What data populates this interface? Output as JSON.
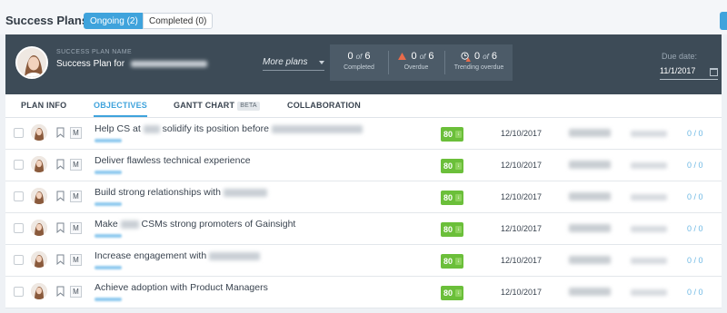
{
  "page": {
    "title": "Success Plans",
    "filters": [
      {
        "label": "Ongoing (2)",
        "active": true
      },
      {
        "label": "Completed (0)",
        "active": false
      }
    ]
  },
  "plan_header": {
    "label": "SUCCESS PLAN NAME",
    "name_prefix": "Success Plan for",
    "more_plans": "More plans",
    "stats": {
      "completed": {
        "value": "0",
        "of": "of",
        "total": "6",
        "label": "Completed"
      },
      "overdue": {
        "value": "0",
        "of": "of",
        "total": "6",
        "label": "Overdue"
      },
      "trending": {
        "value": "0",
        "of": "of",
        "total": "6",
        "label": "Trending overdue"
      }
    },
    "due_label": "Due date:",
    "due_value": "11/1/2017"
  },
  "tabs": [
    {
      "label": "PLAN INFO",
      "active": false
    },
    {
      "label": "OBJECTIVES",
      "active": true
    },
    {
      "label": "GANTT CHART",
      "badge": "BETA",
      "active": false
    },
    {
      "label": "COLLABORATION",
      "active": false
    }
  ],
  "objectives": [
    {
      "text": "Help CS at",
      "text_mid": "solidify its position before",
      "m": "M",
      "score": "80",
      "date": "12/10/2017",
      "tasks": "0 / 0"
    },
    {
      "text": "Deliver flawless technical experience",
      "m": "M",
      "score": "80",
      "date": "12/10/2017",
      "tasks": "0 / 0"
    },
    {
      "text": "Build strong relationships with",
      "m": "M",
      "score": "80",
      "date": "12/10/2017",
      "tasks": "0 / 0"
    },
    {
      "text": "Make",
      "text_mid": "CSMs strong promoters of Gainsight",
      "m": "M",
      "score": "80",
      "date": "12/10/2017",
      "tasks": "0 / 0"
    },
    {
      "text": "Increase engagement with",
      "m": "M",
      "score": "80",
      "date": "12/10/2017",
      "tasks": "0 / 0"
    },
    {
      "text": "Achieve adoption with Product Managers",
      "m": "M",
      "score": "80",
      "date": "12/10/2017",
      "tasks": "0 / 0"
    }
  ],
  "icons": {
    "avatar": "avatar-icon",
    "bookmark": "bookmark-icon",
    "calendar": "calendar-icon",
    "warning": "warning-icon",
    "clock": "clock-warning-icon",
    "caret": "caret-down-icon"
  },
  "colors": {
    "accent": "#3fa3dc",
    "header_bg": "#3d4b57",
    "score_green": "#6bbf3a",
    "warning": "#e96b4a"
  }
}
